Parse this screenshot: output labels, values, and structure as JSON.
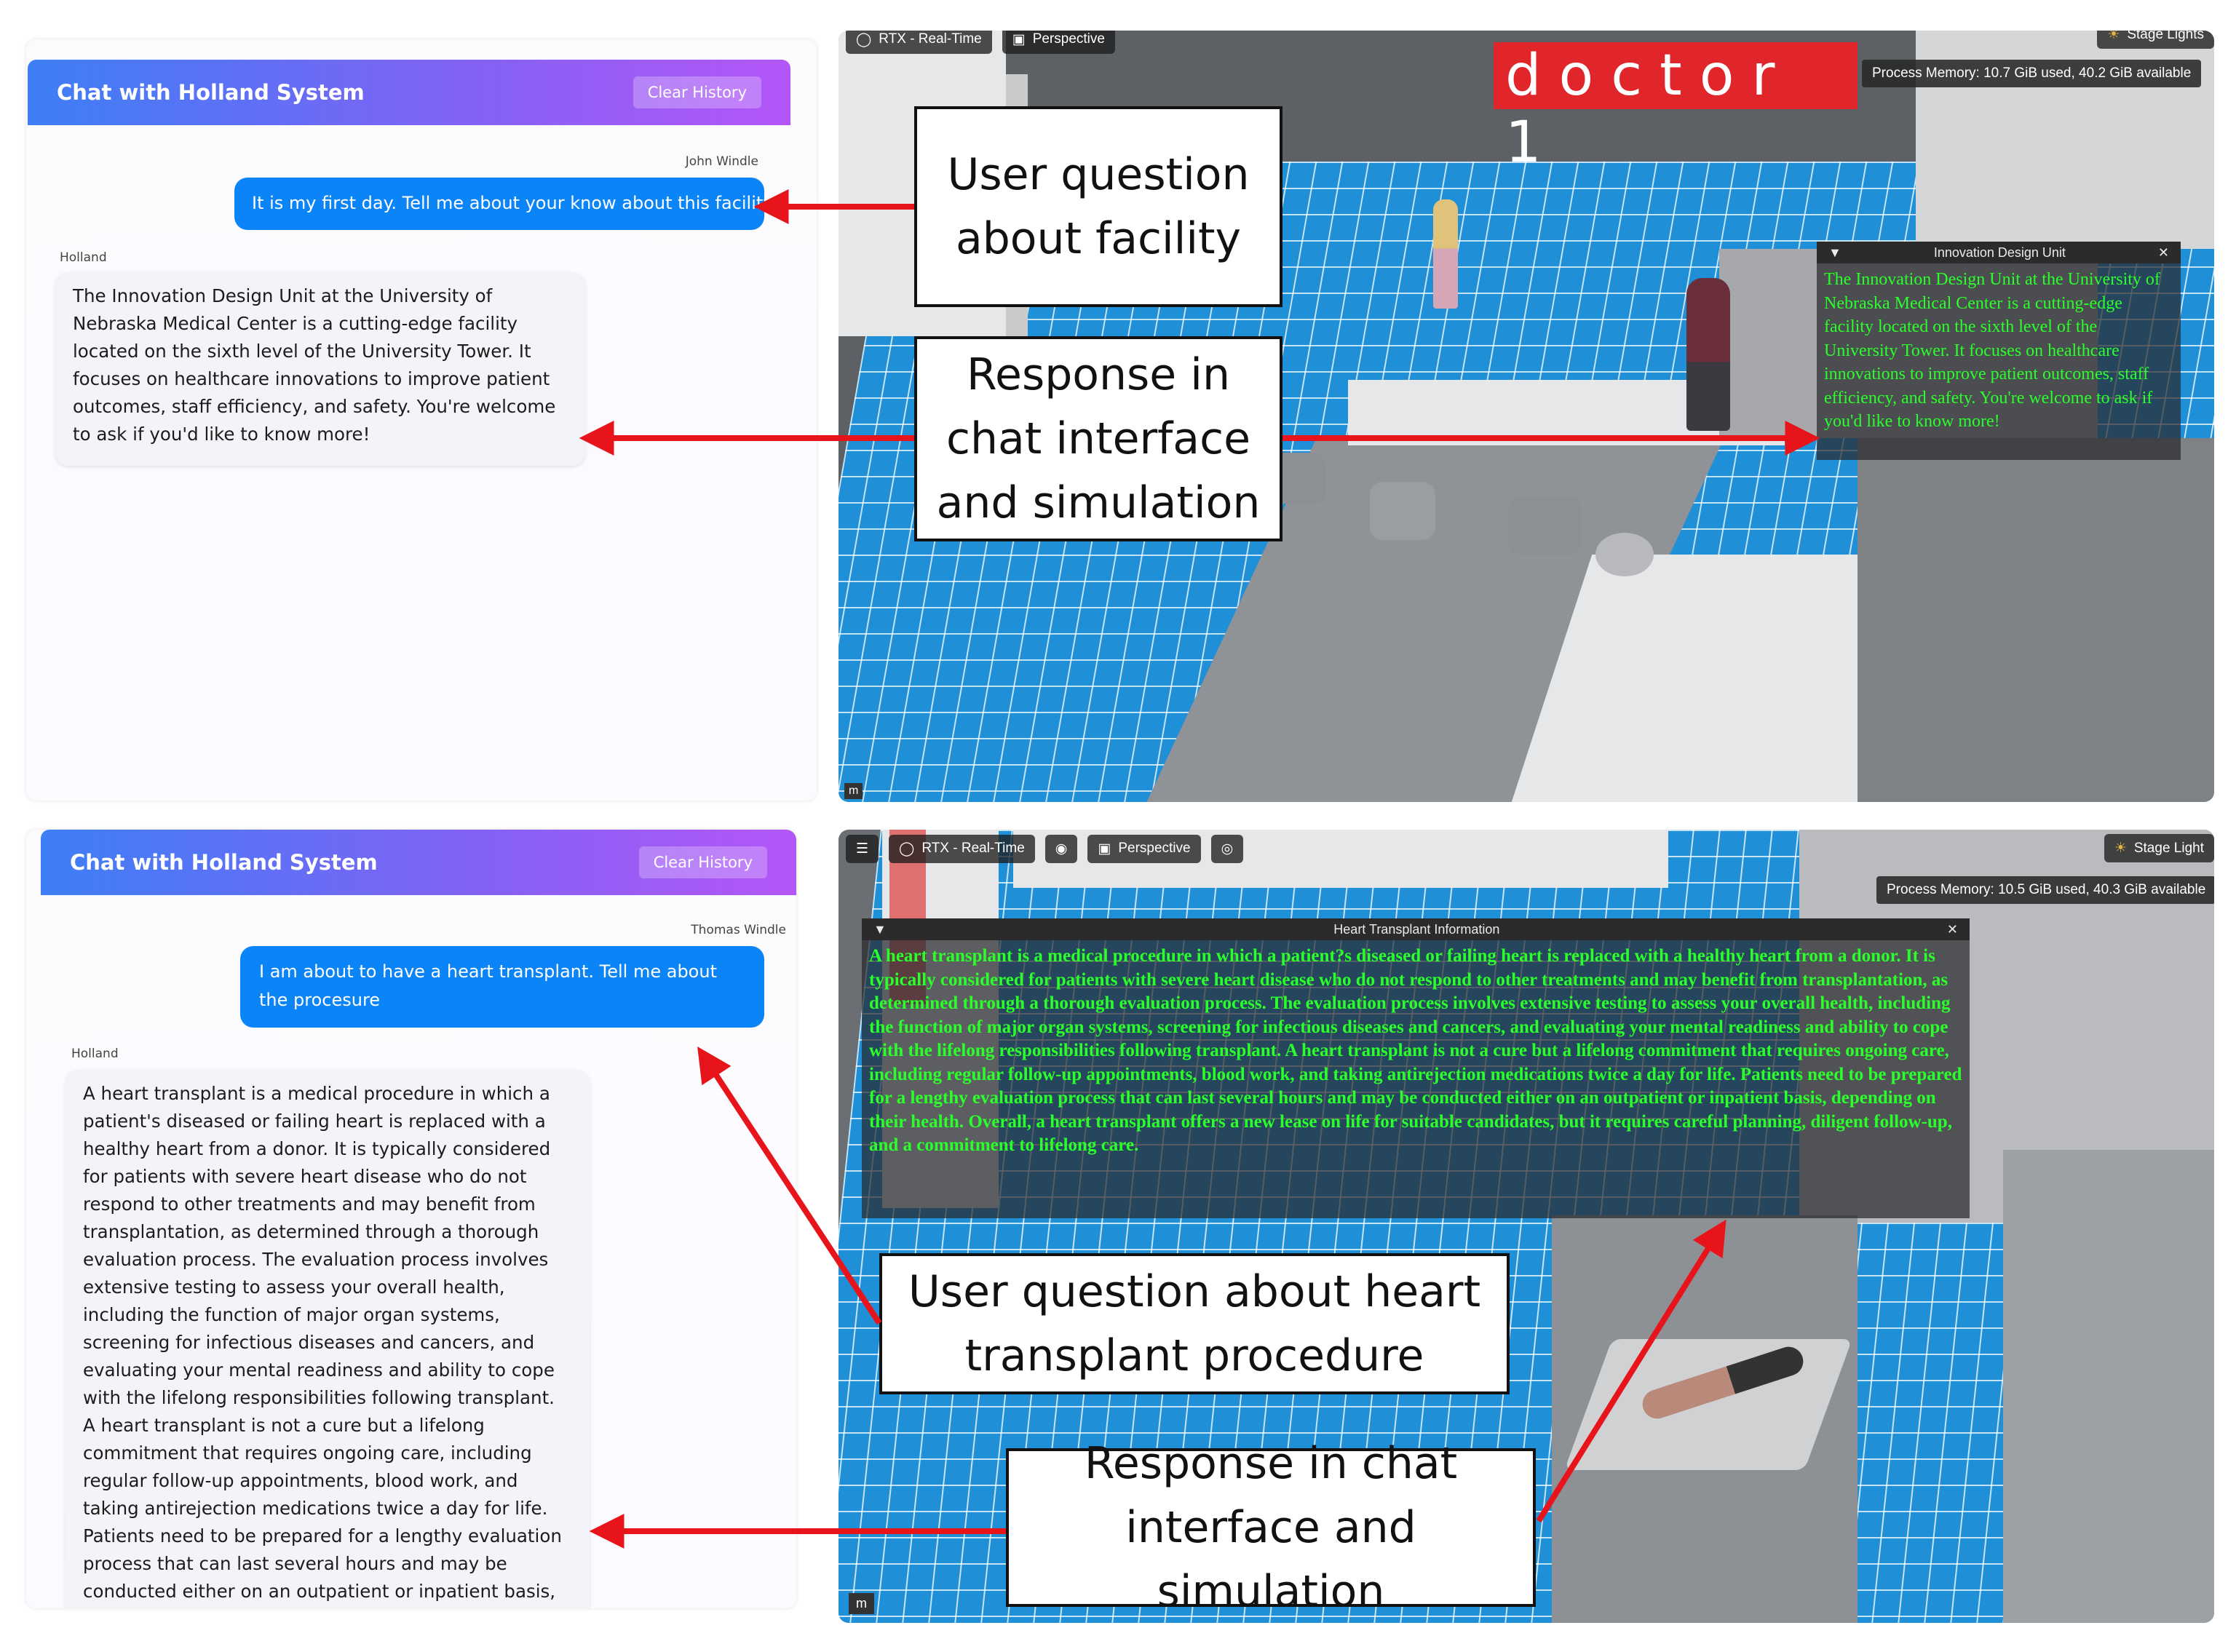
{
  "top": {
    "chat": {
      "title": "Chat with Holland System",
      "clear_label": "Clear History",
      "user_name": "John Windle",
      "user_message": "It is my first day. Tell me about your know about this facility.",
      "bot_name": "Holland",
      "bot_message": "The Innovation Design Unit at the University of Nebraska Medical Center is a cutting-edge facility located on the sixth level of the University Tower. It focuses on healthcare innovations to improve patient outcomes, staff efficiency, and safety. You're welcome to ask if you'd like to know more!"
    },
    "sim": {
      "toolbar": [
        "RTX - Real-Time",
        "Perspective",
        "Stage Lights"
      ],
      "sign_text": "doctor 1",
      "memory": "Process Memory: 10.7 GiB used, 40.2 GiB available",
      "window_title": "Innovation Design Unit",
      "window_text": "The Innovation Design Unit at the University of Nebraska Medical Center is a cutting-edge facility located on the sixth level of the University Tower. It focuses on healthcare innovations to improve patient outcomes, staff efficiency, and safety. You're welcome to ask if you'd like to know more!",
      "corner_label": "m"
    },
    "annotations": {
      "question": "User question about facility",
      "response": "Response in chat interface and simulation"
    }
  },
  "bottom": {
    "chat": {
      "title": "Chat with Holland System",
      "clear_label": "Clear History",
      "user_name": "Thomas Windle",
      "user_message": "I am about to have a heart transplant. Tell me about the procesure",
      "bot_name": "Holland",
      "bot_message": "A heart transplant is a medical procedure in which a patient's diseased or failing heart is replaced with a healthy heart from a donor. It is typically considered for patients with severe heart disease who do not respond to other treatments and may benefit from transplantation, as determined through a thorough evaluation process. The evaluation process involves extensive testing to assess your overall health, including the function of major organ systems, screening for infectious diseases and cancers, and evaluating your mental readiness and ability to cope with the lifelong responsibilities following transplant. A heart transplant is not a cure but a lifelong commitment that requires ongoing care, including regular follow-up appointments, blood work, and taking antirejection medications twice a day for life. Patients need to be prepared for a lengthy evaluation process that can last several hours and may be conducted either on an outpatient or inpatient basis, depending on their health."
    },
    "sim": {
      "toolbar": [
        "RTX - Real-Time",
        "Perspective",
        "Stage Light"
      ],
      "memory": "Process Memory: 10.5 GiB used, 40.3 GiB available",
      "window_title": "Heart Transplant Information",
      "window_text": "A heart transplant is a medical procedure in which a patient?s diseased or failing heart is replaced with a healthy heart from a donor. It is typically considered for patients with severe heart disease who do not respond to other treatments and may benefit from transplantation, as determined through a thorough evaluation process. The evaluation process involves extensive testing to assess your overall health, including the function of major organ systems, screening for infectious diseases and cancers, and evaluating your mental readiness and ability to cope with the lifelong responsibilities following transplant. A heart transplant is not a cure but a lifelong commitment that requires ongoing care, including regular follow-up appointments, blood work, and taking antirejection medications twice a day for life. Patients need to be prepared for a lengthy evaluation process that can last several hours and may be conducted either on an outpatient or inpatient basis, depending on their health. Overall, a heart transplant offers a new lease on life for suitable candidates, but it requires careful planning, diligent follow-up, and a commitment to lifelong care.",
      "corner_label": "m"
    },
    "annotations": {
      "question": "User question about heart transplant procedure",
      "response": "Response in chat interface and simulation"
    }
  },
  "colors": {
    "accent_blue": "#0b84f7",
    "header_gradient_start": "#3d7ff6",
    "header_gradient_end": "#b456f7",
    "arrow_red": "#e8141b",
    "sim_text_green": "#2bff2b",
    "floor_tile_blue": "#1f8fd8"
  }
}
